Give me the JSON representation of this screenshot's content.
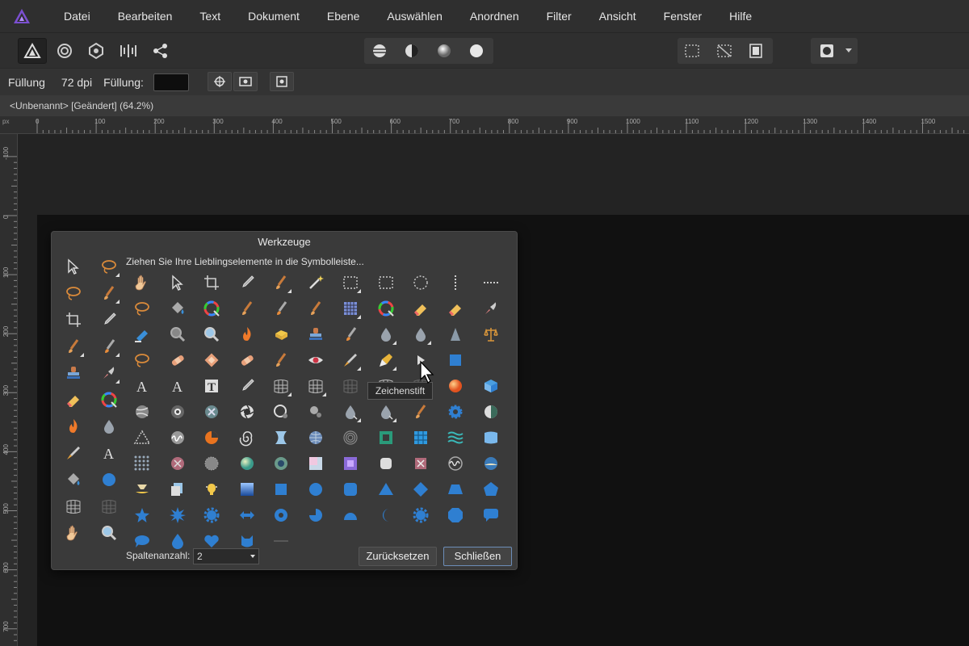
{
  "menubar": {
    "items": [
      "Datei",
      "Bearbeiten",
      "Text",
      "Dokument",
      "Ebene",
      "Auswählen",
      "Anordnen",
      "Filter",
      "Ansicht",
      "Fenster",
      "Hilfe"
    ]
  },
  "toolbar": {
    "persona_icons": [
      "designer-persona-icon",
      "pixel-persona-icon",
      "export-persona-icon",
      "sync-persona-icon",
      "share-icon"
    ],
    "boolean_icons": [
      "align-icon",
      "contrast-icon",
      "gradient-sphere-icon",
      "sphere-icon"
    ],
    "selection_icons": [
      "marquee-icon",
      "slice-icon",
      "grid-icon"
    ],
    "mask_icon": "mask-icon"
  },
  "contextbar": {
    "fill_label": "Füllung",
    "dpi_value": "72 dpi",
    "fill_label2": "Füllung:",
    "fill_color": "#0e0e0e"
  },
  "document": {
    "tab_title": "<Unbenannt> [Geändert] (64.2%)"
  },
  "ruler": {
    "unit": "px",
    "h_labels": [
      "0",
      "100",
      "200",
      "300",
      "400",
      "500",
      "600",
      "700",
      "800",
      "900",
      "1000",
      "1100",
      "1200",
      "1300",
      "1400",
      "1500"
    ],
    "v_labels": [
      "-100",
      "0",
      "100",
      "200",
      "300",
      "400",
      "500",
      "600",
      "700"
    ]
  },
  "tools_dialog": {
    "title": "Werkzeuge",
    "hint": "Ziehen Sie Ihre Lieblingselemente in die Symbolleiste...",
    "column_count_label": "Spaltenanzahl:",
    "column_count_value": "2",
    "reset_label": "Zurücksetzen",
    "close_label": "Schließen",
    "tooltip": "Zeichenstift"
  },
  "colors": {
    "accent_blue": "#2f7fd1",
    "panel_bg": "#3a3a3a",
    "logo_purple": "#7b4fd1"
  }
}
